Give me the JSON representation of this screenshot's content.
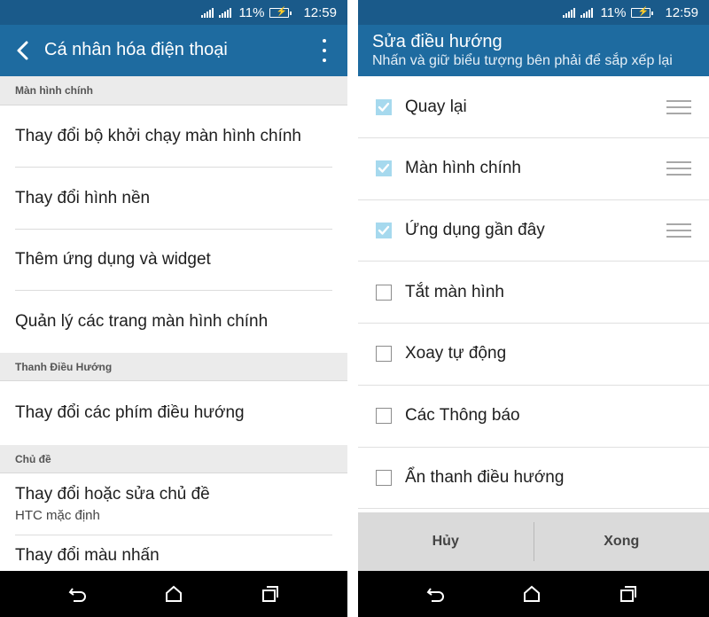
{
  "status": {
    "battery": "11%",
    "time": "12:59",
    "signal_icons": [
      "signal-3g-icon",
      "signal-2g-icon"
    ],
    "battery_icon": "battery-charging-icon"
  },
  "left": {
    "title": "Cá nhân hóa điện thoại",
    "sections": [
      {
        "header": "Màn hình chính",
        "items": [
          "Thay đổi bộ khởi chạy màn hình chính",
          "Thay đổi hình nền",
          "Thêm ứng dụng và widget",
          "Quản lý các trang màn hình chính"
        ]
      },
      {
        "header": "Thanh Điều Hướng",
        "items": [
          "Thay đổi các phím điều hướng"
        ]
      },
      {
        "header": "Chủ đề",
        "items": [
          "Thay đổi hoặc sửa chủ đề",
          "Thay đổi màu nhấn"
        ],
        "theme_sub": "HTC mặc định"
      }
    ]
  },
  "right": {
    "title": "Sửa điều hướng",
    "subtitle": "Nhấn và giữ biểu tượng bên phải để sắp xếp lại",
    "options": [
      {
        "label": "Quay lại",
        "checked": true
      },
      {
        "label": "Màn hình chính",
        "checked": true
      },
      {
        "label": "Ứng dụng gần đây",
        "checked": true
      },
      {
        "label": "Tắt màn hình",
        "checked": false
      },
      {
        "label": "Xoay tự động",
        "checked": false
      },
      {
        "label": "Các Thông báo",
        "checked": false
      },
      {
        "label": "Ẩn thanh điều hướng",
        "checked": false
      }
    ],
    "cancel": "Hủy",
    "done": "Xong"
  },
  "colors": {
    "status_bar": "#1a5a8a",
    "app_bar": "#1e6ba0",
    "checkbox_checked": "#a6d9ee"
  }
}
